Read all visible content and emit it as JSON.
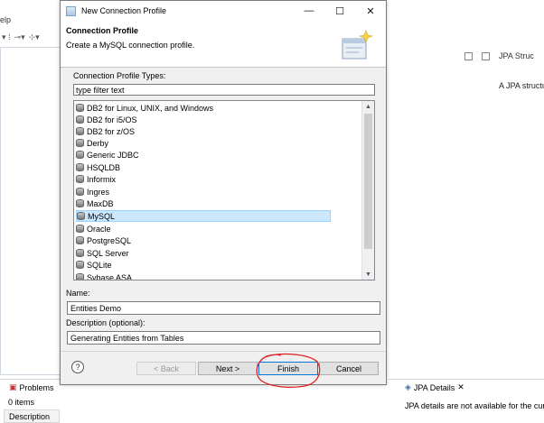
{
  "ide": {
    "menu_fragment": "elp",
    "right_panel_tab": "JPA Struc",
    "right_panel_text": "A JPA structu",
    "problems_tab": "Problems",
    "problems_count": "0 items",
    "description_header": "Description",
    "jpa_details_tab": "JPA Details",
    "jpa_details_close": "✕",
    "jpa_details_message": "JPA details are not available for the curren"
  },
  "dialog": {
    "title": "New Connection Profile",
    "minimize_glyph": "—",
    "maximize_glyph": "☐",
    "close_glyph": "✕",
    "header_title": "Connection Profile",
    "header_subtitle": "Create a MySQL connection profile.",
    "types_label": "Connection Profile Types:",
    "filter_value": "type filter text",
    "profile_types": [
      "DB2 for Linux, UNIX, and Windows",
      "DB2 for i5/OS",
      "DB2 for z/OS",
      "Derby",
      "Generic JDBC",
      "HSQLDB",
      "Informix",
      "Ingres",
      "MaxDB",
      "MySQL",
      "Oracle",
      "PostgreSQL",
      "SQL Server",
      "SQLite",
      "Sybase ASA"
    ],
    "selected_type": "MySQL",
    "name_label": "Name:",
    "name_value": "Entities Demo",
    "description_label": "Description (optional):",
    "description_value": "Generating Entities from Tables",
    "help_glyph": "?",
    "buttons": {
      "back": "< Back",
      "next": "Next >",
      "finish": "Finish",
      "cancel": "Cancel"
    }
  },
  "colors": {
    "selection": "#cce8ff",
    "default_button_border": "#0078d7",
    "annotation": "#e02020"
  }
}
